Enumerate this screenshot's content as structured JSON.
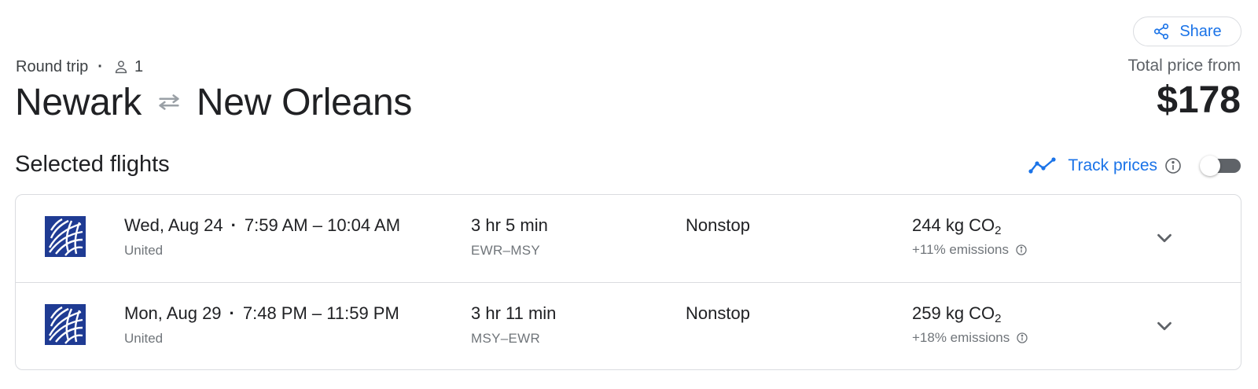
{
  "header": {
    "share_label": "Share",
    "trip_type": "Round trip",
    "passengers": "1",
    "origin": "Newark",
    "destination": "New Orleans",
    "price_label": "Total price from",
    "price": "$178"
  },
  "section": {
    "title": "Selected flights",
    "track_label": "Track prices",
    "track_enabled": false
  },
  "flights": [
    {
      "date": "Wed, Aug 24",
      "times": "7:59 AM – 10:04 AM",
      "airline": "United",
      "duration": "3 hr 5 min",
      "route": "EWR–MSY",
      "stops": "Nonstop",
      "co2": "244 kg CO",
      "co2_sub": "2",
      "emissions": "+11% emissions"
    },
    {
      "date": "Mon, Aug 29",
      "times": "7:48 PM – 11:59 PM",
      "airline": "United",
      "duration": "3 hr 11 min",
      "route": "MSY–EWR",
      "stops": "Nonstop",
      "co2": "259 kg CO",
      "co2_sub": "2",
      "emissions": "+18% emissions"
    }
  ],
  "icons": {
    "share": "share-icon",
    "person": "person-icon",
    "swap": "swap-arrows-icon",
    "trend": "trend-line-icon",
    "info": "info-icon",
    "airline": "united-globe-logo",
    "expand": "chevron-down-icon"
  },
  "colors": {
    "accent": "#1a73e8",
    "text": "#202124",
    "secondary_text": "#70757a",
    "border": "#dadce0",
    "united_blue": "#1f3b93"
  }
}
